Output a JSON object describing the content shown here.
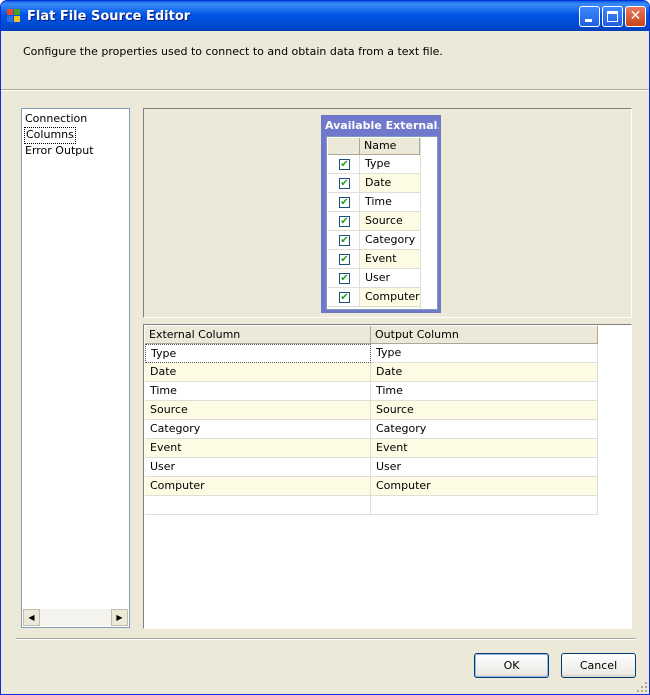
{
  "window": {
    "title": "Flat File Source Editor",
    "accent": "#0055e5",
    "close_color": "#c94416"
  },
  "description": "Configure the properties used to connect to and obtain data from a text file.",
  "nav": {
    "items": [
      {
        "label": "Connection"
      },
      {
        "label": "Columns"
      },
      {
        "label": "Error Output"
      }
    ],
    "selected": "Columns"
  },
  "available": {
    "title": "Available External...",
    "header_name": "Name",
    "columns": [
      {
        "name": "Type",
        "checked": true
      },
      {
        "name": "Date",
        "checked": true
      },
      {
        "name": "Time",
        "checked": true
      },
      {
        "name": "Source",
        "checked": true
      },
      {
        "name": "Category",
        "checked": true
      },
      {
        "name": "Event",
        "checked": true
      },
      {
        "name": "User",
        "checked": true
      },
      {
        "name": "Computer",
        "checked": true
      }
    ]
  },
  "mapping": {
    "headers": [
      "External Column",
      "Output Column"
    ],
    "rows": [
      [
        "Type",
        "Type"
      ],
      [
        "Date",
        "Date"
      ],
      [
        "Time",
        "Time"
      ],
      [
        "Source",
        "Source"
      ],
      [
        "Category",
        "Category"
      ],
      [
        "Event",
        "Event"
      ],
      [
        "User",
        "User"
      ],
      [
        "Computer",
        "Computer"
      ]
    ],
    "alt_row_color": "#fefbe4"
  },
  "buttons": {
    "ok": "OK",
    "cancel": "Cancel"
  },
  "icons": {
    "minimize": "minimize-icon",
    "maximize": "maximize-icon",
    "close": "close-icon",
    "check": "✔"
  }
}
